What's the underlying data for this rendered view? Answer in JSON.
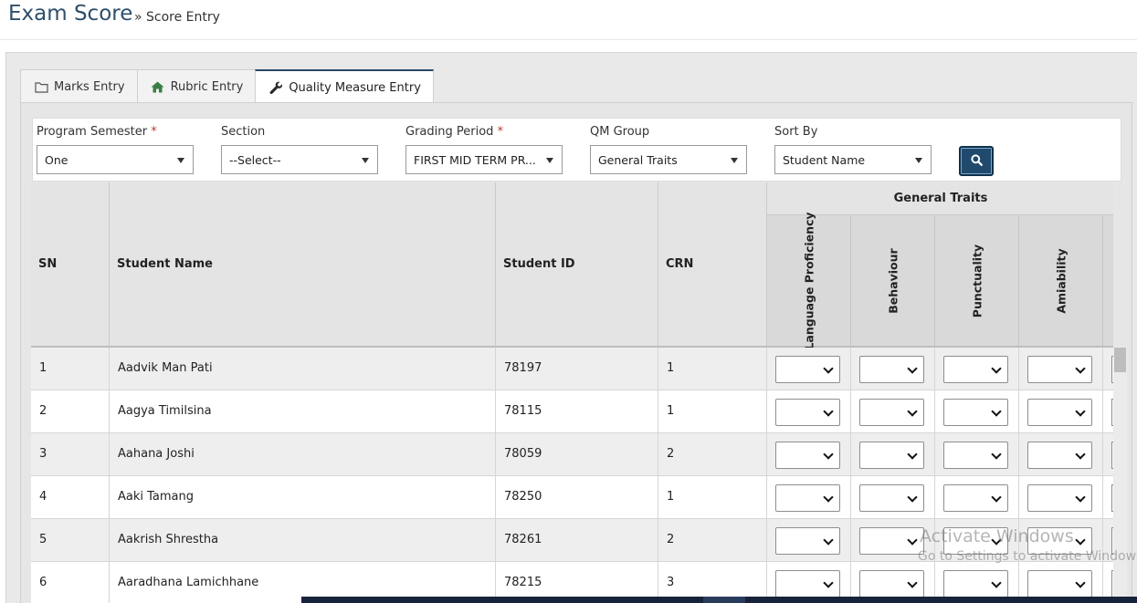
{
  "header": {
    "title": "Exam Score",
    "breadcrumb": "» Score Entry"
  },
  "tabs": [
    {
      "label": "Marks Entry",
      "icon": "folder-icon",
      "active": false
    },
    {
      "label": "Rubric Entry",
      "icon": "home-icon",
      "active": false
    },
    {
      "label": "Quality Measure Entry",
      "icon": "wrench-icon",
      "active": true
    }
  ],
  "filters": {
    "program_semester": {
      "label": "Program Semester",
      "required": "*",
      "value": "One"
    },
    "section": {
      "label": "Section",
      "value": "--Select--"
    },
    "grading_period": {
      "label": "Grading Period",
      "required": "*",
      "value": "FIRST MID TERM PR..."
    },
    "qm_group": {
      "label": "QM Group",
      "value": "General Traits"
    },
    "sort_by": {
      "label": "Sort By",
      "value": "Student Name"
    },
    "search_icon": "search-icon"
  },
  "table": {
    "headers": {
      "sn": "SN",
      "name": "Student Name",
      "id": "Student ID",
      "crn": "CRN"
    },
    "group": "General Traits",
    "traits": [
      "Language Proficiency",
      "Behaviour",
      "Punctuality",
      "Amiability"
    ],
    "rows": [
      {
        "sn": "1",
        "name": "Aadvik Man Pati",
        "id": "78197",
        "crn": "1"
      },
      {
        "sn": "2",
        "name": "Aagya Timilsina",
        "id": "78115",
        "crn": "1"
      },
      {
        "sn": "3",
        "name": "Aahana Joshi",
        "id": "78059",
        "crn": "2"
      },
      {
        "sn": "4",
        "name": "Aaki Tamang",
        "id": "78250",
        "crn": "1"
      },
      {
        "sn": "5",
        "name": "Aakrish Shrestha",
        "id": "78261",
        "crn": "2"
      },
      {
        "sn": "6",
        "name": "Aaradhana Lamichhane",
        "id": "78215",
        "crn": "3"
      }
    ]
  },
  "watermark": {
    "line1": "Activate Windows",
    "line2": "Go to Settings to activate Windows."
  },
  "colors": {
    "accent": "#2d4f6b",
    "button": "#1f4a6e",
    "required": "#c0392b"
  }
}
